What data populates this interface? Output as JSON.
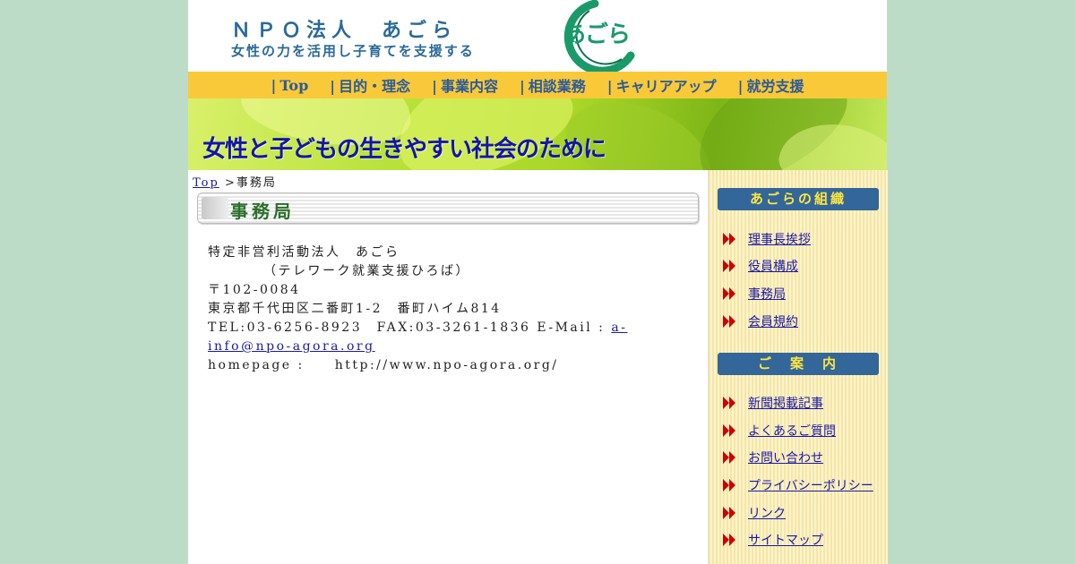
{
  "header": {
    "org_title": "ＮＰＯ法人　あごら",
    "tagline": "女性の力を活用し子育てを支援する",
    "logo_text": "あごら"
  },
  "nav": [
    {
      "label": "Top"
    },
    {
      "label": "目的・理念"
    },
    {
      "label": "事業内容"
    },
    {
      "label": "相談業務"
    },
    {
      "label": "キャリアアップ"
    },
    {
      "label": "就労支援"
    }
  ],
  "nav_separator": "|",
  "banner": {
    "text": "女性と子どもの生きやすい社会のために"
  },
  "breadcrumb": {
    "link": "Top",
    "separator": ">",
    "current": "事務局"
  },
  "section_title": "事務局",
  "info": {
    "org_name": "特定非営利活動法人　あごら",
    "sub_name": "（テレワーク就業支援ひろば）",
    "postal": "〒102-0084",
    "address": "東京都千代田区二番町1-2　番町ハイム814",
    "contact_prefix": "TEL:03-6256-8923　FAX:03-3261-1836 E-Mail : ",
    "email": "a-info@npo-agora.org",
    "homepage_label": "homepage :",
    "homepage_url": "http://www.npo-agora.org/"
  },
  "sidebar": {
    "heading_1": "あごらの組織",
    "links_1": [
      {
        "label": "理事長挨拶"
      },
      {
        "label": "役員構成"
      },
      {
        "label": "事務局"
      },
      {
        "label": "会員規約"
      }
    ],
    "heading_2": "ご　案　内",
    "links_2": [
      {
        "label": "新聞掲載記事"
      },
      {
        "label": "よくあるご質問"
      },
      {
        "label": "お問い合わせ"
      },
      {
        "label": "プライバシーポリシー"
      },
      {
        "label": "リンク"
      },
      {
        "label": "サイトマップ"
      }
    ]
  },
  "colors": {
    "background": "#bcdcc8",
    "nav_bar": "#f9c93a",
    "brand_blue": "#2a6a9a",
    "banner_text": "#1414a8",
    "sidebar_heading": "#336699",
    "sidebar_heading_text": "#ffe640",
    "link": "#1a1aaa",
    "arrow": "#cc0000"
  }
}
